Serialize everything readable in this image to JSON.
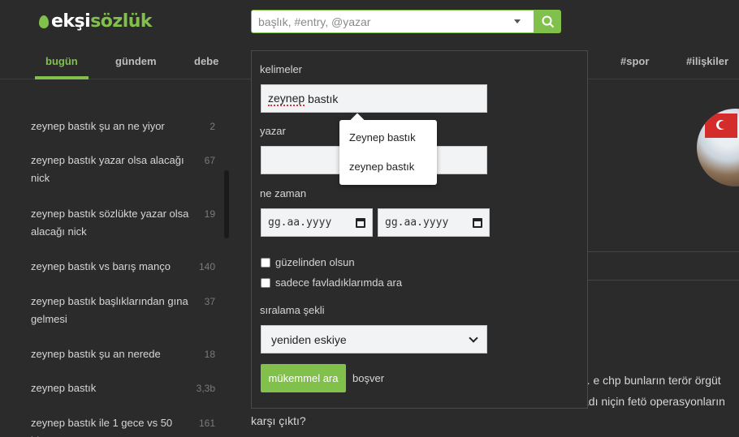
{
  "logo": {
    "part1": "ekşi",
    "part2": "sözlük"
  },
  "search": {
    "placeholder": "başlık, #entry, @yazar"
  },
  "nav": {
    "tabs": [
      "bugün",
      "gündem",
      "debe"
    ],
    "right_tabs": [
      "#spor",
      "#ilişkiler"
    ]
  },
  "topics": [
    {
      "title": "zeynep bastık şu an ne yiyor",
      "count": "2"
    },
    {
      "title": "zeynep bastık yazar olsa alacağı nick",
      "count": "67"
    },
    {
      "title": "zeynep bastık sözlükte yazar olsa alacağı nick",
      "count": "19"
    },
    {
      "title": "zeynep bastık vs barış manço",
      "count": "140"
    },
    {
      "title": "zeynep bastık başlıklarından gına gelmesi",
      "count": "37"
    },
    {
      "title": "zeynep bastık şu an nerede",
      "count": "18"
    },
    {
      "title": "zeynep bastık",
      "count": "3,3b"
    },
    {
      "title": "zeynep bastık ile 1 gece vs 50 bin",
      "count": "161"
    }
  ],
  "background_text": {
    "line1": "ur. e chp bunların terör örgüt",
    "line2": "adı niçin fetö operasyonların",
    "line3": "karşı çıktı?"
  },
  "panel": {
    "keywords_label": "kelimeler",
    "keywords_value": "zeynep bastık",
    "keywords_value_a": "zeynep",
    "keywords_value_b": " bastık",
    "author_label": "yazar",
    "author_value": "",
    "date_label": "ne zaman",
    "date_from_placeholder": "gg.aa.yyyy",
    "date_to_placeholder": "gg.aa.yyyy",
    "check_nice": "güzelinden olsun",
    "check_favs": "sadece favladıklarımda ara",
    "sort_label": "sıralama şekli",
    "sort_value": "yeniden eskiye",
    "submit": "mükemmel ara",
    "reset": "boşver"
  },
  "autocomplete": {
    "options": [
      "Zeynep bastık",
      "zeynep bastık"
    ]
  },
  "colors": {
    "accent": "#81c14b",
    "background": "#2b2b2b"
  }
}
